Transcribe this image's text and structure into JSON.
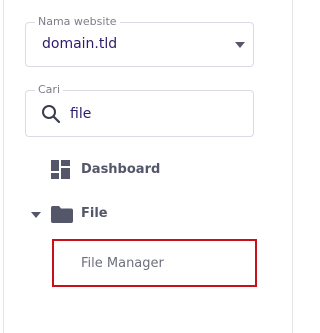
{
  "website_select": {
    "label": "Nama website",
    "value": "domain.tld"
  },
  "search": {
    "label": "Cari",
    "value": "file"
  },
  "nav": {
    "dashboard_label": "Dashboard",
    "file_label": "File",
    "file_manager_label": "File Manager"
  },
  "colors": {
    "accent_text": "#2f1c6a",
    "highlight_border": "#c8101a",
    "icon": "#54566a"
  }
}
